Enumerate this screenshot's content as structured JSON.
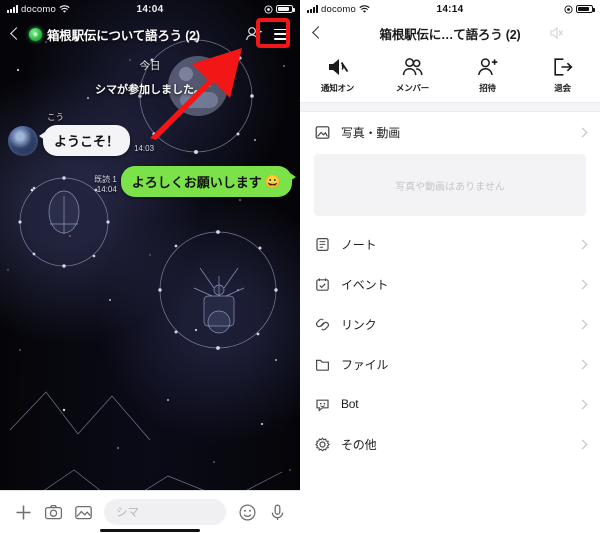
{
  "left": {
    "status": {
      "carrier": "docomo",
      "time": "14:04",
      "wifi_icon": "wifi-icon",
      "battery_icon": "battery-icon"
    },
    "header": {
      "back_icon": "back-chevron-icon",
      "group_avatar_icon": "group-avatar-icon",
      "title": "箱根駅伝について語ろう (2)",
      "add_friend_icon": "add-friend-icon",
      "menu_icon": "hamburger-menu-icon"
    },
    "chat": {
      "day_separator": "今日",
      "system_message": "シマが参加しました。",
      "messages": [
        {
          "direction": "in",
          "sender": "こう",
          "text": "ようこそ！",
          "time": "14:03",
          "read": ""
        },
        {
          "direction": "out",
          "sender": "",
          "text": "よろしくお願いします",
          "emoji": "😀",
          "time": "14:04",
          "read": "既読 1"
        }
      ]
    },
    "input_bar": {
      "plus_icon": "plus-icon",
      "camera_icon": "camera-icon",
      "gallery_icon": "gallery-icon",
      "placeholder": "シマ",
      "emoji_icon": "emoji-icon",
      "mic_icon": "microphone-icon"
    },
    "annotation": {
      "menu_highlight_color": "#f21616",
      "arrow_color": "#f21616"
    }
  },
  "right": {
    "status": {
      "carrier": "docomo",
      "time": "14:14",
      "wifi_icon": "wifi-icon",
      "battery_icon": "battery-icon"
    },
    "header": {
      "back_icon": "back-chevron-icon",
      "title": "箱根駅伝に…て語ろう (2)",
      "mute_icon": "mute-speaker-icon"
    },
    "actions": [
      {
        "icon": "notification-mute-icon",
        "label": "通知オン"
      },
      {
        "icon": "members-icon",
        "label": "メンバー"
      },
      {
        "icon": "invite-icon",
        "label": "招待"
      },
      {
        "icon": "leave-group-icon",
        "label": "退会",
        "highlighted": true
      }
    ],
    "media": {
      "icon": "photo-icon",
      "label": "写真・動画",
      "empty_text": "写真や動画はありません"
    },
    "menu": [
      {
        "icon": "note-icon",
        "label": "ノート"
      },
      {
        "icon": "event-icon",
        "label": "イベント"
      },
      {
        "icon": "link-icon",
        "label": "リンク"
      },
      {
        "icon": "file-icon",
        "label": "ファイル"
      },
      {
        "icon": "bot-icon",
        "label": "Bot"
      },
      {
        "icon": "settings-gear-icon",
        "label": "その他"
      }
    ],
    "annotation": {
      "leave_highlight_color": "#f21616"
    }
  }
}
